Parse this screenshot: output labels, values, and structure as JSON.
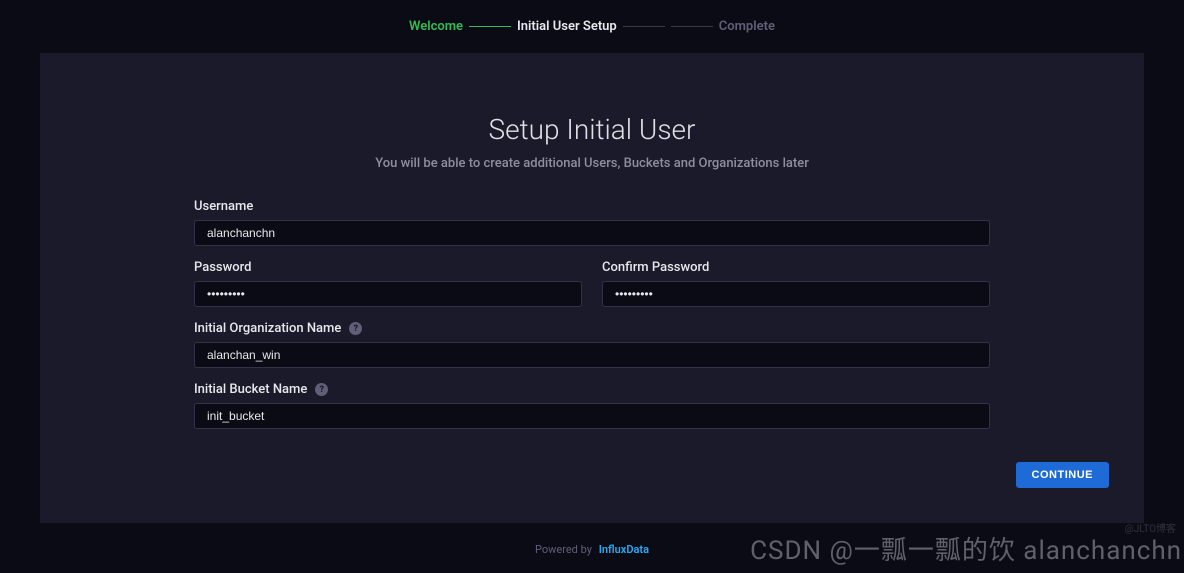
{
  "steps": {
    "welcome": "Welcome",
    "setup": "Initial User Setup",
    "complete": "Complete"
  },
  "title": "Setup Initial User",
  "subtitle": "You will be able to create additional Users, Buckets and Organizations later",
  "form": {
    "username_label": "Username",
    "username_value": "alanchanchn",
    "password_label": "Password",
    "password_value": "•••••••••",
    "confirm_label": "Confirm Password",
    "confirm_value": "•••••••••",
    "org_label": "Initial Organization Name",
    "org_value": "alanchan_win",
    "bucket_label": "Initial Bucket Name",
    "bucket_value": "init_bucket"
  },
  "buttons": {
    "continue": "CONTINUE"
  },
  "footer": {
    "powered": "Powered by",
    "brand": "InfluxData"
  },
  "watermark": {
    "main": "CSDN @一瓢一瓢的饮 alanchanchn",
    "small": "@JLTO博客"
  }
}
